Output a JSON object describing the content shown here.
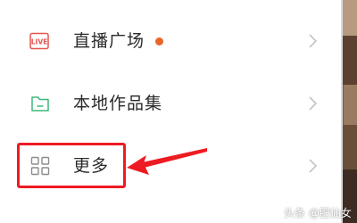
{
  "menu": {
    "items": [
      {
        "label": "直播广场",
        "icon": "live-icon",
        "icon_text": "LIVE",
        "has_badge": true
      },
      {
        "label": "本地作品集",
        "icon": "folder-icon",
        "has_badge": false
      },
      {
        "label": "更多",
        "icon": "grid-icon",
        "has_badge": false
      }
    ],
    "chevron_icon": "chevron-right-icon"
  },
  "annotation": {
    "highlight_color": "#ee1b22",
    "arrow_icon": "arrow-left-icon"
  },
  "colors": {
    "icon_red": "#e6554f",
    "icon_green": "#3cb97a",
    "icon_gray": "#8c8c8c",
    "badge_orange": "#e8652a",
    "chevron_gray": "#c4c4c4"
  },
  "watermark": {
    "text": "头条 @肥仙女"
  }
}
